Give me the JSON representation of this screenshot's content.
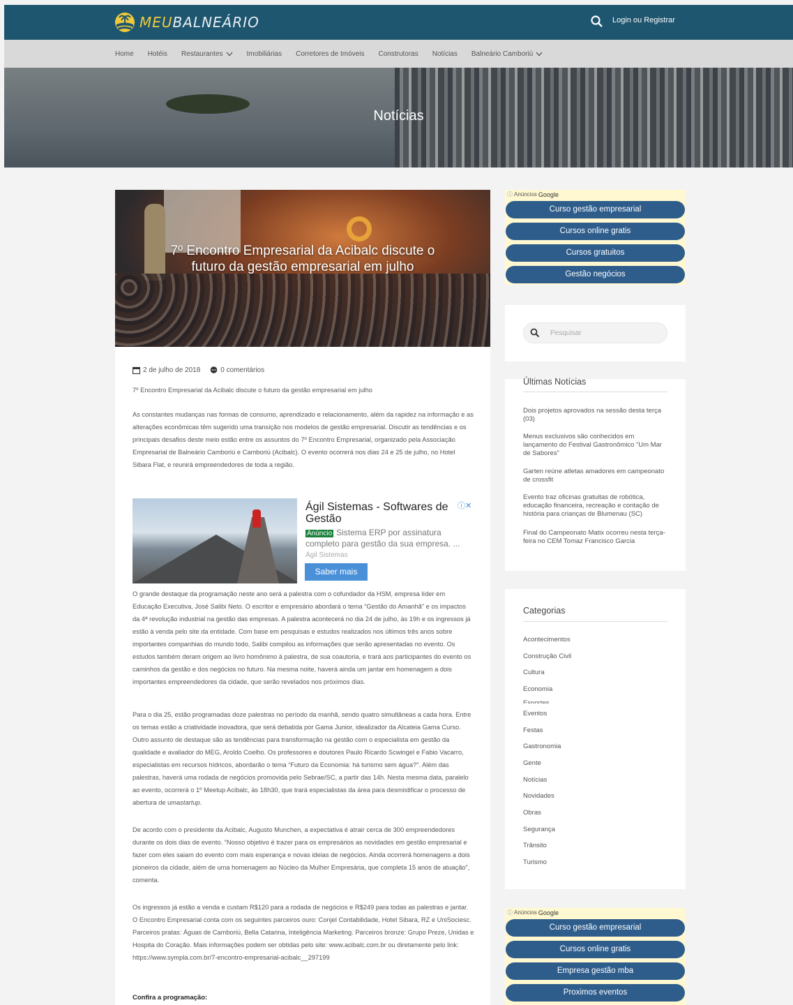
{
  "header": {
    "logo_text_accent": "MEU",
    "logo_text_main": "BALNEÁRIO",
    "login_label": "Login ou Registrar"
  },
  "nav": {
    "items": [
      {
        "label": "Home"
      },
      {
        "label": "Hotéis"
      },
      {
        "label": "Restaurantes",
        "has_dropdown": true
      },
      {
        "label": "Imobiliárias"
      },
      {
        "label": "Corretores de Imóveis"
      },
      {
        "label": "Construtoras"
      },
      {
        "label": "Notícias"
      },
      {
        "label": "Balneário Camboriú",
        "has_dropdown": true
      }
    ]
  },
  "hero": {
    "title": "Notícias"
  },
  "feature": {
    "title": "7º Encontro Empresarial da Acibalc discute o futuro da gestão empresarial em julho"
  },
  "article": {
    "date": "2 de julho de 2018",
    "comments": "0 comentários",
    "intro": "7º Encontro Empresarial da Acibalc discute o futuro da gestão empresarial em julho",
    "p1": "As constantes mudanças nas formas de consumo, aprendizado e relacionamento, além da rapidez na informação e as alterações econômicas têm sugerido uma transição nos modelos de gestão empresarial. Discutir as tendências e os principais desafios deste meio estão entre os assuntos do 7º Encontro Empresarial, organizado pela Associação Empresarial de Balneário Camboriú e Camboriú (Acibalc). O evento ocorrerá nos dias 24 e 25 de julho, no Hotel Sibara Flat, e reunirá empreendedores de toda a região.",
    "p2": "O grande destaque da programação neste ano será a palestra com o cofundador da HSM, empresa líder em Educação Executiva, José Salibi Neto. O escritor e empresário abordará o tema “Gestão do Amanhã” e os impactos da 4ª revolução industrial na gestão das empresas. A palestra acontecerá no dia 24 de julho, às 19h e os ingressos já estão à venda pelo site da entidade. Com base em pesquisas e estudos realizados nos últimos três anos sobre importantes companhias do mundo todo, Salibi compilou as informações que serão apresentadas no evento. Os estudos também deram origem ao livro homônimo à palestra, de sua coautoria, e trará aos participantes do evento os caminhos da gestão e dos negócios no futuro. Na mesma noite, haverá ainda um jantar em homenagem a dois importantes empreendedores da cidade, que serão revelados nos próximos dias.",
    "p3": "Para o dia 25, estão programadas doze palestras no período da manhã, sendo quatro simultâneas a cada hora. Entre os temas estão a criatividade inovadora, que será debatida por Gama Junior, idealizador da Alcateia Gama Curso. Outro assunto de destaque são as tendências para transformação na gestão com o especialista em gestão da qualidade e avaliador do MEG, Aroldo Coelho. Os professores e doutores Paulo Ricardo Scwingel e Fabio Vacarro, especialistas em recursos hídricos, abordarão o tema “Futuro da Economia: há turismo sem água?”. Além das palestras, haverá uma rodada de negócios promovida pelo Sebrae/SC, a partir das 14h. Nesta mesma data, paralelo ao evento, ocorrerá o 1º Meetup Acibalc, às 18h30, que trará especialistas da área para desmistificar o processo de abertura de uma",
    "p3_italic": "startup",
    "p3_end": ".",
    "p4": "De acordo com o presidente da Acibalc, Augusto Munchen, a expectativa é atrair cerca de 300 empreendedores durante os dois dias de evento. “Nosso objetivo é trazer para os empresários as novidades em gestão empresarial e fazer com eles saiam do evento com mais esperança e novas ideias de negócios. Ainda ocorrerá homenagens a dois pioneiros da cidade, além de uma homenagem ao Núcleo da Mulher Empresária, que completa 15 anos de atuação”, comenta.",
    "p5": "Os ingressos já estão a venda e custam R$120 para a rodada de negócios e R$249 para todas as palestras e jantar. O Encontro Empresarial conta com os seguintes parceiros ouro: Conjel Contabilidade, Hotel Sibara, RZ e UniSociesc. Parceiros pratas: Águas de Camboriú, Bella Catarina, Inteligência Marketing. Parceiros bronze: Grupo Preze, Unidas e Hospita do Coração. Mais informações podem ser obtidas pelo site: www.acibalc.com.br ou diretamente pelo link: https://www.sympla.com.br/7-encontro-empresarial-acibalc__297199",
    "section_heading": "Confira a programação:"
  },
  "inline_ad": {
    "title": "Ágil Sistemas - Softwares de Gestão",
    "badge": "Anúncio",
    "description": "Sistema ERP por assinatura completo para gestão da sua empresa. ...",
    "source": "Ágil Sistemas",
    "cta": "Saber mais"
  },
  "sidebar": {
    "ad_label_small": "Anúncios",
    "ad_label_brand": "Google",
    "ad_top": [
      "Curso gestão empresarial",
      "Cursos online gratis",
      "Cursos gratuitos",
      "Gestão negócios"
    ],
    "search_placeholder": "Pesquisar",
    "latest_title": "Últimas Notícias",
    "latest": [
      "Dois projetos aprovados na sessão desta terça (03)",
      "Menus exclusivos são conhecidos em lançamento do Festival Gastronômico “Um Mar de Sabores”",
      "Garten reúne atletas amadores em campeonato de crossfit",
      "Evento traz oficinas gratuitas de robótica, educação financeira, recreação e contação de história para crianças de Blumenau (SC)",
      "Final do Campeonato Matix ocorreu nesta terça-feira no CEM Tomaz Francisco Garcia"
    ],
    "categories_title": "Categorias",
    "categories": [
      "Acontecimentos",
      "Construção Civil",
      "Cultura",
      "Economia",
      "Esportes",
      "Eventos",
      "Festas",
      "Gastronomia",
      "Gente",
      "Notícias",
      "Novidades",
      "Obras",
      "Segurança",
      "Trânsito",
      "Turismo"
    ],
    "ad_bottom": [
      "Curso gestão empresarial",
      "Cursos online gratis",
      "Empresa gestão mba",
      "Proximos eventos"
    ]
  },
  "colors": {
    "header_bg": "#1e5670",
    "nav_bg": "#d9d9d9",
    "ad_button": "#2e5d8c",
    "logo_accent": "#f0c93a"
  }
}
